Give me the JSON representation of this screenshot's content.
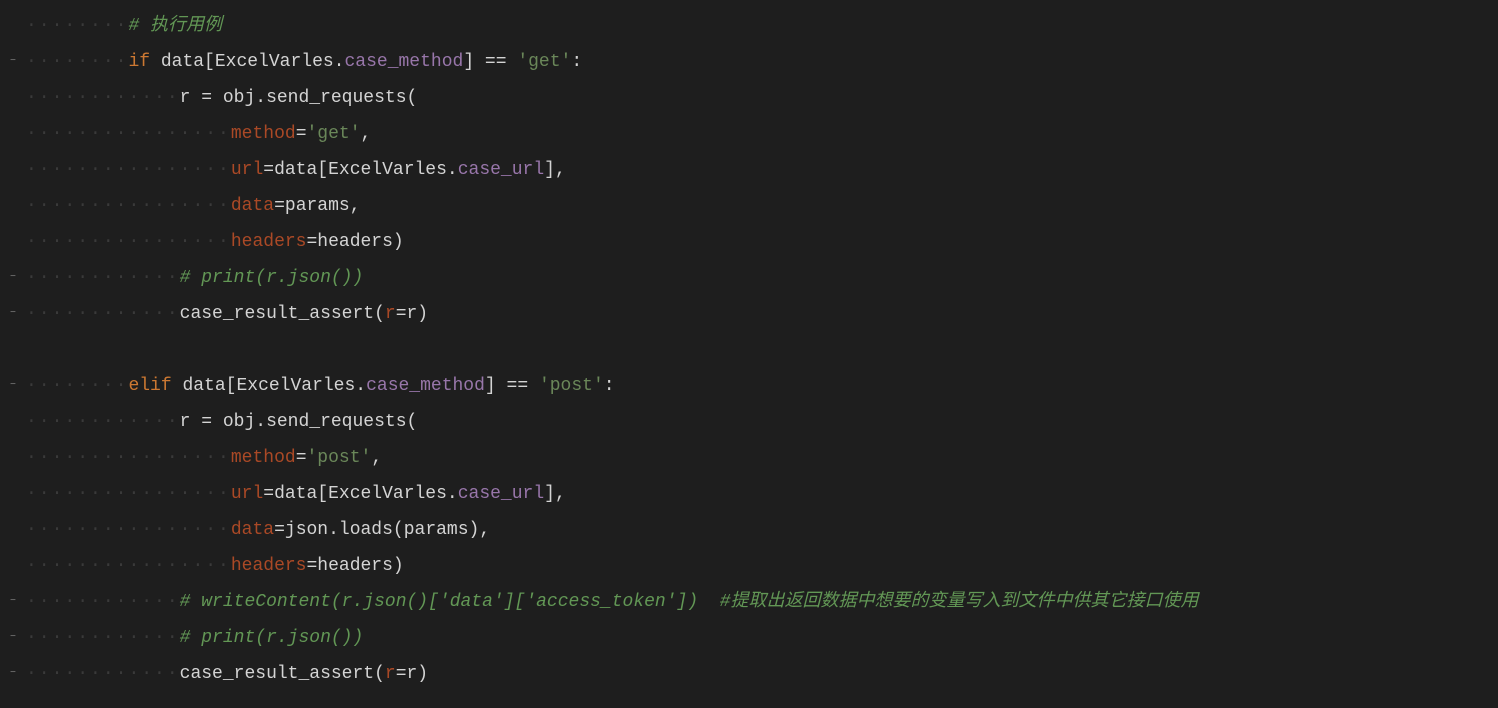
{
  "lines": [
    {
      "indent": 2,
      "tokens": [
        {
          "cls": "comment",
          "text": "# 执行用例"
        }
      ]
    },
    {
      "indent": 2,
      "tokens": [
        {
          "cls": "keyword",
          "text": "if "
        },
        {
          "cls": "ident",
          "text": "data[ExcelVarles."
        },
        {
          "cls": "attr",
          "text": "case_method"
        },
        {
          "cls": "ident",
          "text": "] == "
        },
        {
          "cls": "string",
          "text": "'get'"
        },
        {
          "cls": "ident",
          "text": ":"
        }
      ]
    },
    {
      "indent": 3,
      "tokens": [
        {
          "cls": "ident",
          "text": "r = obj.send_requests("
        }
      ]
    },
    {
      "indent": 4,
      "tokens": [
        {
          "cls": "param",
          "text": "method"
        },
        {
          "cls": "ident",
          "text": "="
        },
        {
          "cls": "string",
          "text": "'get'"
        },
        {
          "cls": "ident",
          "text": ","
        }
      ]
    },
    {
      "indent": 4,
      "tokens": [
        {
          "cls": "param",
          "text": "url"
        },
        {
          "cls": "ident",
          "text": "=data[ExcelVarles."
        },
        {
          "cls": "attr",
          "text": "case_url"
        },
        {
          "cls": "ident",
          "text": "],"
        }
      ]
    },
    {
      "indent": 4,
      "tokens": [
        {
          "cls": "param",
          "text": "data"
        },
        {
          "cls": "ident",
          "text": "=params,"
        }
      ]
    },
    {
      "indent": 4,
      "tokens": [
        {
          "cls": "param",
          "text": "headers"
        },
        {
          "cls": "ident",
          "text": "=headers)"
        }
      ]
    },
    {
      "indent": 3,
      "tokens": [
        {
          "cls": "comment",
          "text": "# print(r.json())"
        }
      ]
    },
    {
      "indent": 3,
      "tokens": [
        {
          "cls": "ident",
          "text": "case_result_assert("
        },
        {
          "cls": "param",
          "text": "r"
        },
        {
          "cls": "ident",
          "text": "=r)"
        }
      ]
    },
    {
      "indent": 0,
      "tokens": []
    },
    {
      "indent": 2,
      "tokens": [
        {
          "cls": "keyword",
          "text": "elif "
        },
        {
          "cls": "ident",
          "text": "data[ExcelVarles."
        },
        {
          "cls": "attr",
          "text": "case_method"
        },
        {
          "cls": "ident",
          "text": "] == "
        },
        {
          "cls": "string",
          "text": "'post'"
        },
        {
          "cls": "ident",
          "text": ":"
        }
      ]
    },
    {
      "indent": 3,
      "tokens": [
        {
          "cls": "ident",
          "text": "r = obj.send_requests("
        }
      ]
    },
    {
      "indent": 4,
      "tokens": [
        {
          "cls": "param",
          "text": "method"
        },
        {
          "cls": "ident",
          "text": "="
        },
        {
          "cls": "string",
          "text": "'post'"
        },
        {
          "cls": "ident",
          "text": ","
        }
      ]
    },
    {
      "indent": 4,
      "tokens": [
        {
          "cls": "param",
          "text": "url"
        },
        {
          "cls": "ident",
          "text": "=data[ExcelVarles."
        },
        {
          "cls": "attr",
          "text": "case_url"
        },
        {
          "cls": "ident",
          "text": "],"
        }
      ]
    },
    {
      "indent": 4,
      "tokens": [
        {
          "cls": "param",
          "text": "data"
        },
        {
          "cls": "ident",
          "text": "=json.loads(params),"
        }
      ]
    },
    {
      "indent": 4,
      "tokens": [
        {
          "cls": "param",
          "text": "headers"
        },
        {
          "cls": "ident",
          "text": "=headers)"
        }
      ]
    },
    {
      "indent": 3,
      "tokens": [
        {
          "cls": "comment",
          "text": "# writeContent(r.json()['data']['access_token'])  #提取出返回数据中想要的变量写入到文件中供其它接口使用"
        }
      ]
    },
    {
      "indent": 3,
      "tokens": [
        {
          "cls": "comment",
          "text": "# print(r.json())"
        }
      ]
    },
    {
      "indent": 3,
      "tokens": [
        {
          "cls": "ident",
          "text": "case_result_assert("
        },
        {
          "cls": "param",
          "text": "r"
        },
        {
          "cls": "ident",
          "text": "=r)"
        }
      ]
    }
  ],
  "fold_markers": [
    1,
    7,
    8,
    10,
    16,
    17,
    18
  ]
}
